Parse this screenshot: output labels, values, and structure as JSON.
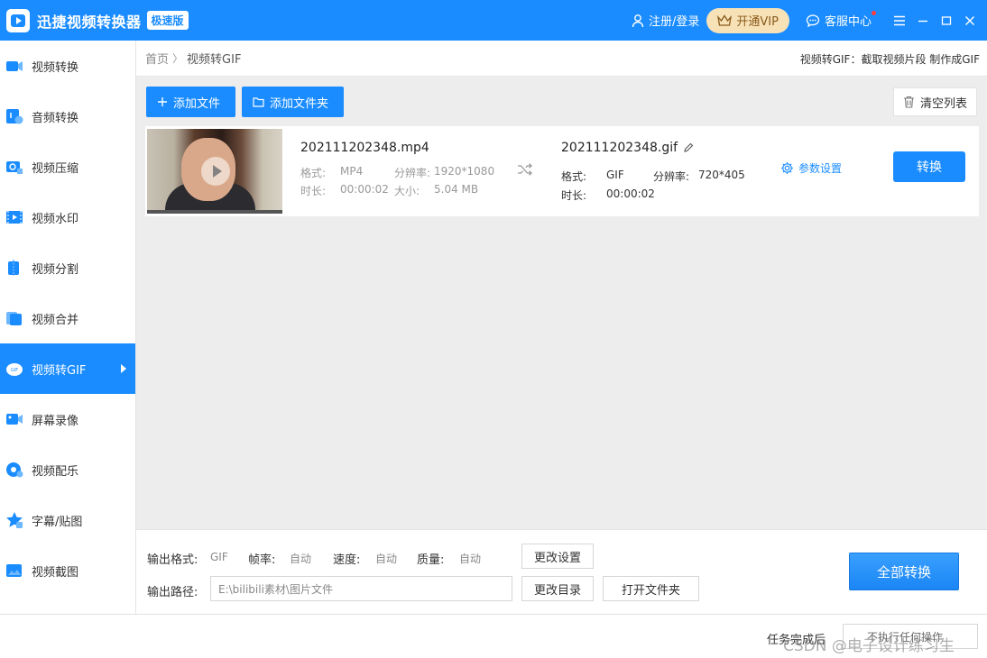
{
  "titlebar": {
    "app_title": "迅捷视频转换器",
    "edition_badge": "极速版",
    "login_label": "注册/登录",
    "vip_label": "开通VIP",
    "service_label": "客服中心"
  },
  "sidebar": {
    "items": [
      {
        "label": "视频转换",
        "icon": "video-convert-icon"
      },
      {
        "label": "音频转换",
        "icon": "audio-convert-icon"
      },
      {
        "label": "视频压缩",
        "icon": "video-compress-icon"
      },
      {
        "label": "视频水印",
        "icon": "video-watermark-icon"
      },
      {
        "label": "视频分割",
        "icon": "video-split-icon"
      },
      {
        "label": "视频合并",
        "icon": "video-merge-icon"
      },
      {
        "label": "视频转GIF",
        "icon": "video-gif-icon",
        "active": true
      },
      {
        "label": "屏幕录像",
        "icon": "screen-record-icon"
      },
      {
        "label": "视频配乐",
        "icon": "video-music-icon"
      },
      {
        "label": "字幕/贴图",
        "icon": "subtitle-sticker-icon"
      },
      {
        "label": "视频截图",
        "icon": "video-screenshot-icon"
      }
    ]
  },
  "breadcrumb": {
    "home": "首页",
    "separator": "〉",
    "current": "视频转GIF",
    "description": "视频转GIF：截取视频片段 制作成GIF"
  },
  "toolbar": {
    "add_file_label": "添加文件",
    "add_folder_label": "添加文件夹",
    "clear_list_label": "清空列表"
  },
  "file": {
    "source_name": "202111202348.mp4",
    "format_label": "格式:",
    "format_value": "MP4",
    "resolution_label": "分辨率:",
    "resolution_value": "1920*1080",
    "duration_label": "时长:",
    "duration_value": "00:00:02",
    "size_label": "大小:",
    "size_value": "5.04 MB",
    "output_name": "202111202348.gif",
    "out_format_label": "格式:",
    "out_format_value": "GIF",
    "out_resolution_label": "分辨率:",
    "out_resolution_value": "720*405",
    "out_duration_label": "时长:",
    "out_duration_value": "00:00:02",
    "params_label": "参数设置",
    "convert_label": "转换"
  },
  "settings": {
    "output_format_label": "输出格式:",
    "output_format_value": "GIF",
    "frame_rate_label": "帧率:",
    "frame_rate_value": "自动",
    "speed_label": "速度:",
    "speed_value": "自动",
    "quality_label": "质量:",
    "quality_value": "自动",
    "change_settings_label": "更改设置",
    "output_path_label": "输出路径:",
    "output_path_value": "E:\\bilibili素材\\图片文件",
    "change_dir_label": "更改目录",
    "open_folder_label": "打开文件夹",
    "convert_all_label": "全部转换"
  },
  "statusbar": {
    "after_task_label": "任务完成后",
    "after_task_value": "不执行任何操作",
    "watermark": "CSDN @电子设计练习生"
  },
  "colors": {
    "accent": "#1a8cff",
    "vip_bg": "#f7e2b8",
    "main_bg": "#ededed"
  }
}
